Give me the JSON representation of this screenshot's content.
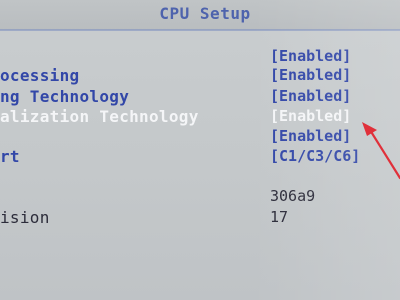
{
  "screen": {
    "title": "CPU Setup"
  },
  "settings": [
    {
      "label": "",
      "value": "[Enabled]"
    },
    {
      "label": "ocessing",
      "value": "[Enabled]"
    },
    {
      "label": "ng Technology",
      "value": "[Enabled]"
    },
    {
      "label": "alization Technology",
      "value": "[Enabled]"
    },
    {
      "label": "",
      "value": "[Enabled]"
    },
    {
      "label": "rt",
      "value": "[C1/C3/C6]"
    }
  ],
  "info": [
    {
      "label": "",
      "value": "306a9"
    },
    {
      "label": "ision",
      "value": "17"
    }
  ],
  "colors": {
    "background": "#c7cbcd",
    "option_text": "#3247a8",
    "selected_text": "#f4f5f7",
    "annotation_arrow": "#e0303a"
  },
  "annotation": {
    "icon": "red-arrow-icon"
  }
}
